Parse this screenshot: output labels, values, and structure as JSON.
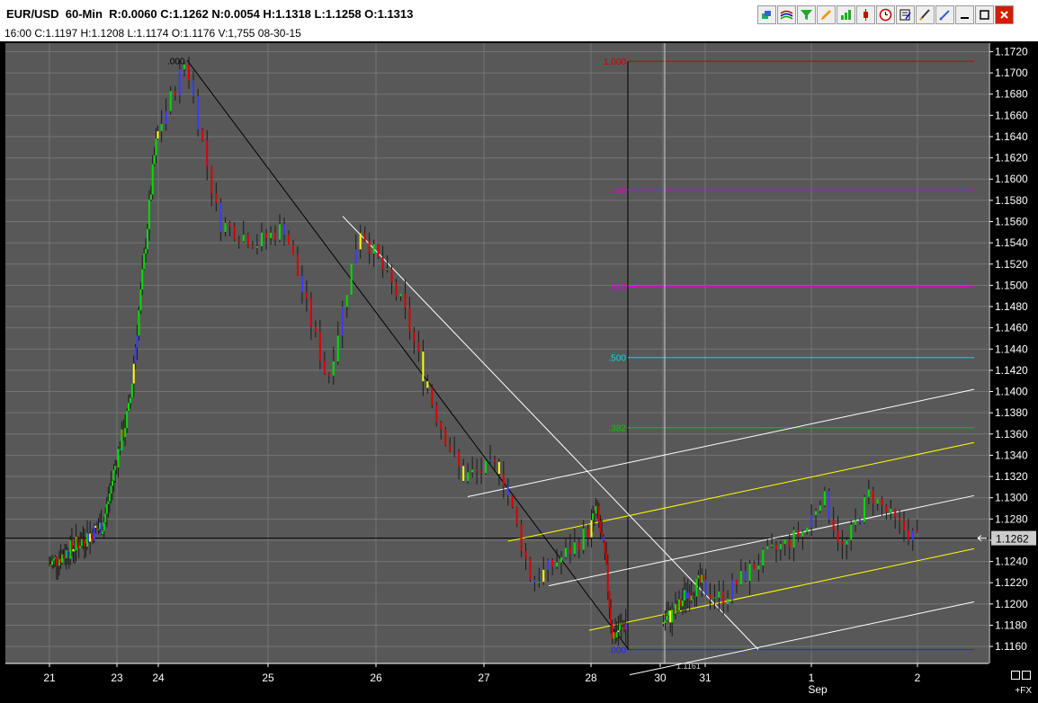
{
  "header": {
    "symbol": "EUR/USD",
    "interval": "60-Min",
    "stats": "R:0.0060  C:1.1262  N:0.0054  H:1.1318  L:1.1258  O:1.1313",
    "bar_info": "16:00  C:1.1197  H:1.1208  L:1.1174  O:1.1176  V:1,755  08-30-15"
  },
  "toolbar": [
    "layers-icon",
    "waves-icon",
    "funnel-icon",
    "pencil-icon",
    "bar-chart-icon",
    "candlestick-icon",
    "clock-icon",
    "notepad-icon",
    "pen-icon",
    "wand-icon",
    "minimize-icon",
    "maximize-icon",
    "close-icon"
  ],
  "colors": {
    "background": "#585858",
    "grid": "#747474",
    "up": "#00dd00",
    "down": "#dd0000",
    "neutral": "#3a3aff",
    "price_line": "#000000",
    "fib_100": "#cc0000",
    "fib_786": "#dd00dd",
    "fib_618": "#dd00dd",
    "fib_500": "#00dddd",
    "fib_382": "#00cc00",
    "fib_000": "#2222ff",
    "channel_outer": "#ffffff",
    "channel_inner": "#ffff00"
  },
  "chart_data": {
    "type": "ohlc",
    "ylim": [
      1.1144,
      1.1728
    ],
    "price_ticks": [
      "1.1720",
      "1.1700",
      "1.1680",
      "1.1660",
      "1.1640",
      "1.1620",
      "1.1600",
      "1.1580",
      "1.1560",
      "1.1540",
      "1.1520",
      "1.1500",
      "1.1480",
      "1.1460",
      "1.1440",
      "1.1420",
      "1.1400",
      "1.1380",
      "1.1360",
      "1.1340",
      "1.1320",
      "1.1300",
      "1.1280",
      "1.1260",
      "1.1240",
      "1.1220",
      "1.1200",
      "1.1180",
      "1.1160"
    ],
    "date_ticks": [
      "21",
      "23",
      "24",
      "25",
      "26",
      "27",
      "28",
      "30",
      "31",
      "1",
      "2"
    ],
    "month_label": "Sep",
    "last_price": "1.1262",
    "low_annotation": "1.1161",
    "fib_levels": [
      {
        "label": "1.000",
        "price": 1.1711,
        "color_key": "fib_100"
      },
      {
        "label": ".786",
        "price": 1.159,
        "color_key": "fib_786"
      },
      {
        "label": ".618",
        "price": 1.1499,
        "color_key": "fib_618"
      },
      {
        "label": ".500",
        "price": 1.1432,
        "color_key": "fib_500"
      },
      {
        "label": ".382",
        "price": 1.1366,
        "color_key": "fib_382"
      },
      {
        "label": ".000",
        "price": 1.1157,
        "color_key": "fib_000"
      }
    ],
    "peak_label": ".000",
    "anchors": [
      {
        "day": 21.0,
        "price": 1.1237
      },
      {
        "day": 22.6,
        "price": 1.1275
      },
      {
        "day": 23.3,
        "price": 1.1385
      },
      {
        "day": 23.9,
        "price": 1.162
      },
      {
        "day": 24.25,
        "price": 1.1712
      },
      {
        "day": 24.55,
        "price": 1.156
      },
      {
        "day": 24.9,
        "price": 1.154
      },
      {
        "day": 25.15,
        "price": 1.1555
      },
      {
        "day": 25.55,
        "price": 1.141
      },
      {
        "day": 25.85,
        "price": 1.1555
      },
      {
        "day": 26.25,
        "price": 1.148
      },
      {
        "day": 26.55,
        "price": 1.138
      },
      {
        "day": 26.8,
        "price": 1.132
      },
      {
        "day": 27.15,
        "price": 1.133
      },
      {
        "day": 27.45,
        "price": 1.122
      },
      {
        "day": 27.85,
        "price": 1.1255
      },
      {
        "day": 28.15,
        "price": 1.129
      },
      {
        "day": 28.4,
        "price": 1.124
      },
      {
        "day": 28.6,
        "price": 1.117
      },
      {
        "day": 29.35,
        "price": 1.1195
      },
      {
        "day": 29.55,
        "price": 1.121
      },
      {
        "day": 29.9,
        "price": 1.122
      },
      {
        "day": 30.15,
        "price": 1.1205
      },
      {
        "day": 30.5,
        "price": 1.124
      },
      {
        "day": 30.95,
        "price": 1.127
      },
      {
        "day": 31.1,
        "price": 1.1305
      },
      {
        "day": 31.3,
        "price": 1.125
      },
      {
        "day": 31.55,
        "price": 1.1305
      },
      {
        "day": 31.8,
        "price": 1.1275
      },
      {
        "day": 32.0,
        "price": 1.1262
      }
    ]
  }
}
